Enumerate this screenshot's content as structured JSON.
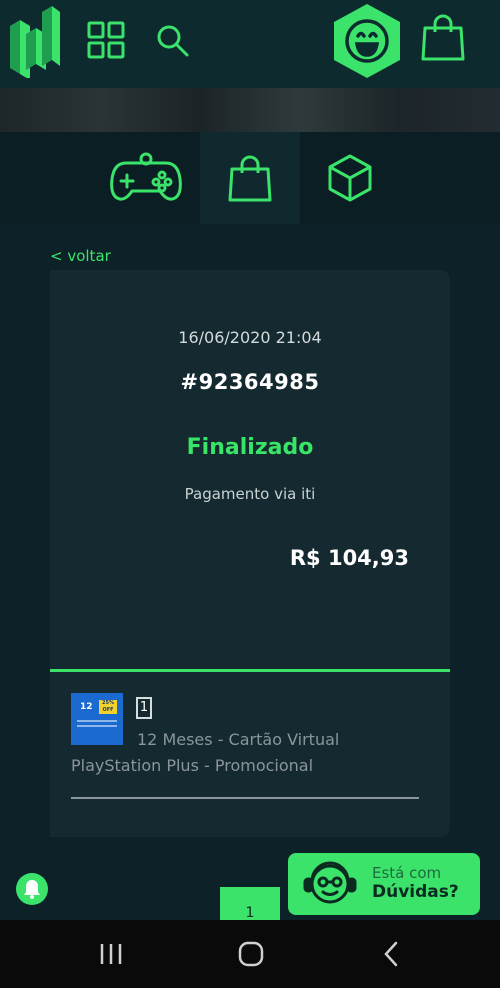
{
  "header": {
    "logo_icon": "logo-icon",
    "menu_icon": "grid-icon",
    "search_icon": "search-icon",
    "profile_icon": "smiley-face-icon",
    "cart_icon": "shopping-bag-icon"
  },
  "tabs": [
    {
      "id": "games",
      "icon": "gamepad-icon"
    },
    {
      "id": "orders",
      "icon": "shopping-bag-icon",
      "active": true
    },
    {
      "id": "products",
      "icon": "cube-icon"
    }
  ],
  "nav": {
    "back_label": "< voltar"
  },
  "order": {
    "date": "16/06/2020 21:04",
    "number": "#92364985",
    "status": "Finalizado",
    "payment": "Pagamento via iti",
    "total": "R$ 104,93"
  },
  "item": {
    "quantity": "1",
    "name_line1": "12 Meses - Cartão Virtual",
    "name_line2": "PlayStation Plus - Promocional",
    "thumb_text": "12",
    "thumb_badge": "25% OFF"
  },
  "pager": {
    "page": "1"
  },
  "help": {
    "line1": "Está com",
    "line2": "Dúvidas?"
  },
  "colors": {
    "accent": "#3be36a",
    "background": "#0c2228",
    "card": "#142a30"
  }
}
